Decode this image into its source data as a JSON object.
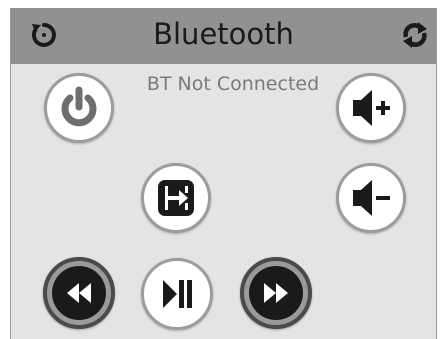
{
  "header": {
    "title": "Bluetooth",
    "left_icon": "refresh-icon",
    "right_icon": "sync-icon"
  },
  "status": {
    "text": "BT Not Connected"
  },
  "controls": {
    "power": "power-icon",
    "volume_up": "volume-up-icon",
    "volume_down": "volume-down-icon",
    "source": "input-source-icon",
    "rewind": "rewind-icon",
    "play_pause": "play-pause-icon",
    "fast_forward": "fast-forward-icon"
  },
  "colors": {
    "header_bg": "#919191",
    "panel_bg": "#e4e4e4",
    "power_gray": "#6e6e6e",
    "icon_dark": "#1a1a1a"
  }
}
